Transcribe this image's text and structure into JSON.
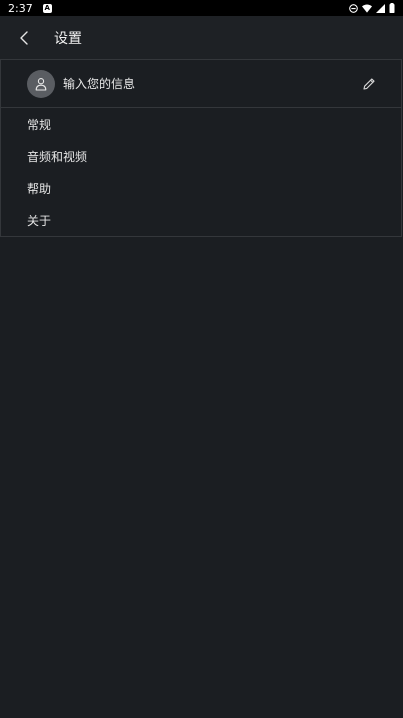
{
  "status_bar": {
    "time": "2:37",
    "notification_letter": "A"
  },
  "header": {
    "title": "设置"
  },
  "profile": {
    "label": "输入您的信息"
  },
  "menu": {
    "items": [
      {
        "label": "常规"
      },
      {
        "label": "音频和视频"
      },
      {
        "label": "帮助"
      },
      {
        "label": "关于"
      }
    ]
  },
  "colors": {
    "background": "#1b1e22",
    "app_bar": "#1e2125",
    "divider": "#34373b",
    "avatar": "#5a5d62"
  }
}
